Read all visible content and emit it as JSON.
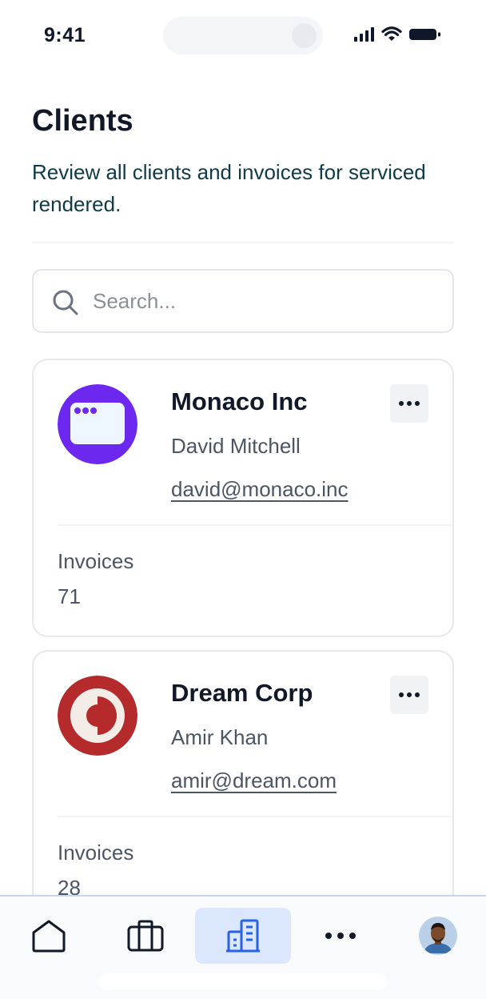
{
  "status_bar": {
    "time": "9:41"
  },
  "header": {
    "title": "Clients",
    "subtitle": "Review all clients and invoices for serviced rendered."
  },
  "search": {
    "placeholder": "Search..."
  },
  "clients": [
    {
      "name": "Monaco Inc",
      "contact": "David Mitchell",
      "email": "david@monaco.inc",
      "invoices_label": "Invoices",
      "invoices_count": "71",
      "logo_color": "#6d28f0"
    },
    {
      "name": "Dream Corp",
      "contact": "Amir Khan",
      "email": "amir@dream.com",
      "invoices_label": "Invoices",
      "invoices_count": "28",
      "logo_color": "#b91c1c"
    }
  ],
  "bottom_nav": {
    "items": [
      "home-icon",
      "briefcase-icon",
      "building-icon",
      "more-icon",
      "profile-avatar"
    ],
    "active": "building-icon",
    "active_bg": "#dbe7fd",
    "accent": "#2563eb"
  }
}
